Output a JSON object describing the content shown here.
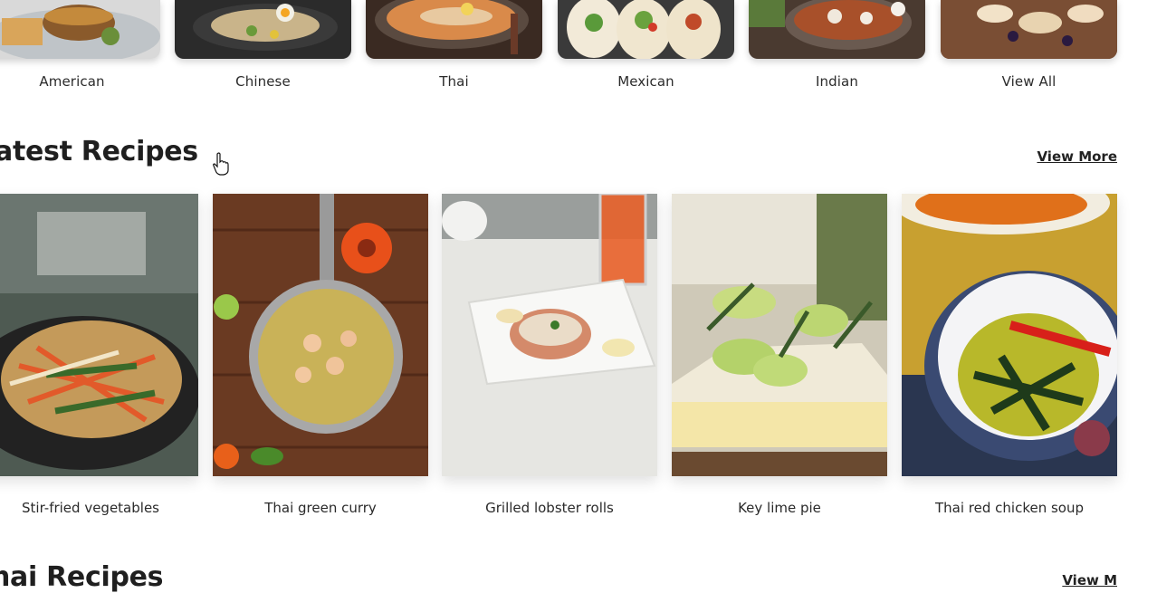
{
  "categories": [
    {
      "label": "American"
    },
    {
      "label": "Chinese"
    },
    {
      "label": "Thai"
    },
    {
      "label": "Mexican"
    },
    {
      "label": "Indian"
    },
    {
      "label": "View All"
    }
  ],
  "latest": {
    "heading": "atest Recipes",
    "view_more": "View More",
    "recipes": [
      {
        "title": "Stir-fried vegetables"
      },
      {
        "title": "Thai green curry"
      },
      {
        "title": "Grilled lobster rolls"
      },
      {
        "title": "Key lime pie"
      },
      {
        "title": "Thai red chicken soup"
      }
    ]
  },
  "next_section": {
    "heading": "hai Recipes",
    "view_more": "View M"
  }
}
